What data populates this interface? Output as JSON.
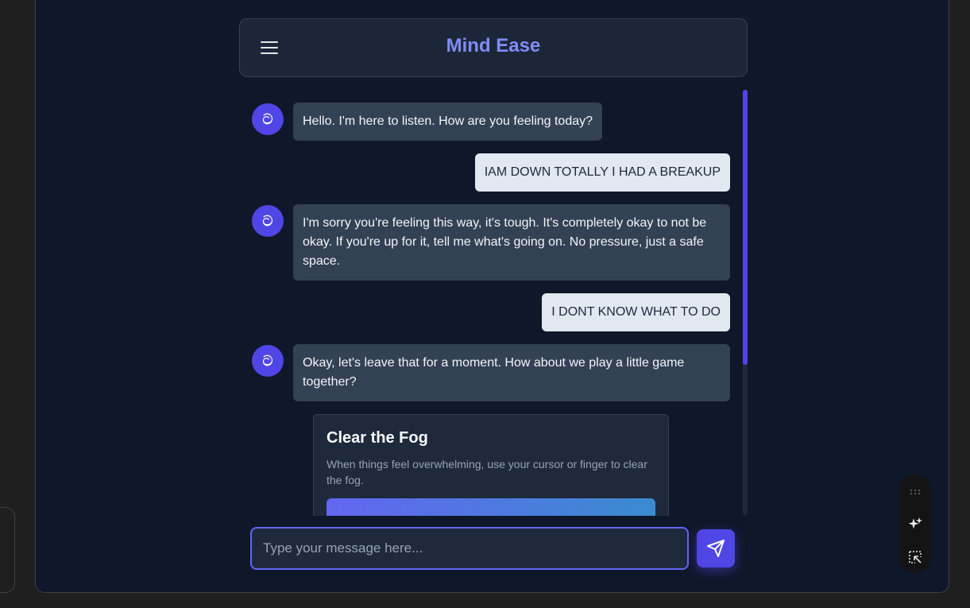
{
  "app": {
    "title": "Mind Ease"
  },
  "header": {
    "menu_icon": "hamburger-menu-icon"
  },
  "messages": [
    {
      "sender": "bot",
      "avatar_glyph": "ට",
      "text": "Hello. I'm here to listen. How are you feeling today?"
    },
    {
      "sender": "user",
      "text": "IAM DOWN TOTALLY I HAD A BREAKUP"
    },
    {
      "sender": "bot",
      "avatar_glyph": "ට",
      "text": "I'm sorry you're feeling this way, it's tough. It's completely okay to not be okay. If you're up for it, tell me what's going on. No pressure, just a safe space."
    },
    {
      "sender": "user",
      "text": "I DONT KNOW WHAT TO DO"
    },
    {
      "sender": "bot",
      "avatar_glyph": "ට",
      "text": "Okay, let's leave that for a moment. How about we play a little game together?"
    }
  ],
  "game": {
    "title": "Clear the Fog",
    "description": "When things feel overwhelming, use your cursor or finger to clear the fog.",
    "gradient_start": "#6366f1",
    "gradient_end": "#3b8bd0"
  },
  "composer": {
    "placeholder": "Type your message here...",
    "value": "",
    "send_icon": "send-icon"
  },
  "dock": {
    "icons": [
      "drag-handle-icon",
      "sparkle-icon",
      "select-area-icon"
    ]
  },
  "colors": {
    "accent": "#4f46e5",
    "title": "#818cf8",
    "background": "#0f172a",
    "bot_bubble": "#334155",
    "user_bubble": "#e2e8f0"
  }
}
